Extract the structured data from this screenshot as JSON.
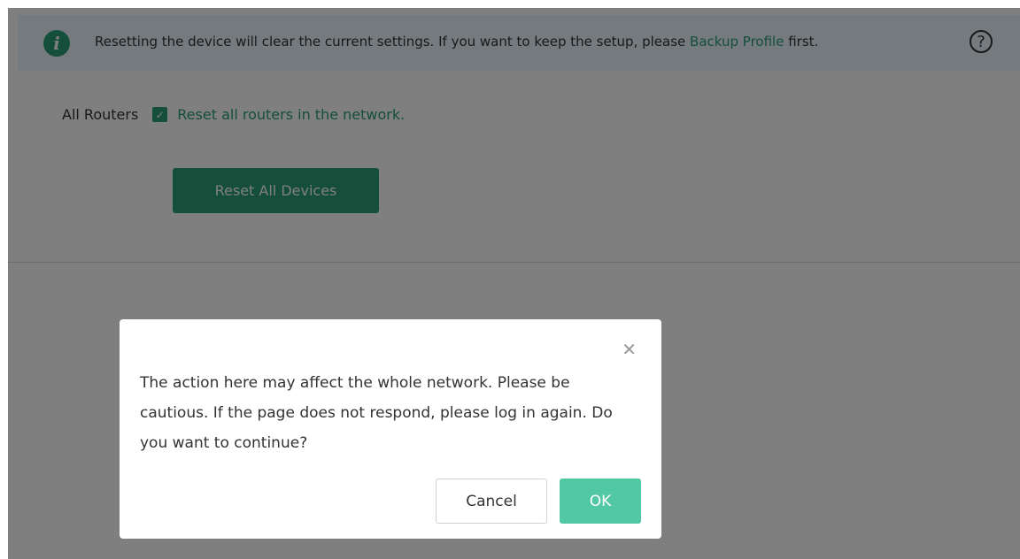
{
  "notice": {
    "text_before": "Resetting the device will clear the current settings. If you want to keep the setup, please ",
    "link_text": "Backup Profile",
    "text_after": " first.",
    "info_icon": "info-icon",
    "help_icon": "help-icon"
  },
  "form": {
    "all_routers_label": "All Routers",
    "reset_all_routers_checked": true,
    "reset_all_routers_text": "Reset all routers in the network.",
    "reset_all_button": "Reset All Devices"
  },
  "dialog": {
    "message": "The action here may affect the whole network. Please be cautious. If the page does not respond, please log in again. Do you want to continue?",
    "close_icon": "close-icon",
    "cancel_label": "Cancel",
    "ok_label": "OK"
  },
  "colors": {
    "accent": "#2a9d74",
    "ok_button": "#52c7a3",
    "notice_bg": "#e8f4fc"
  }
}
